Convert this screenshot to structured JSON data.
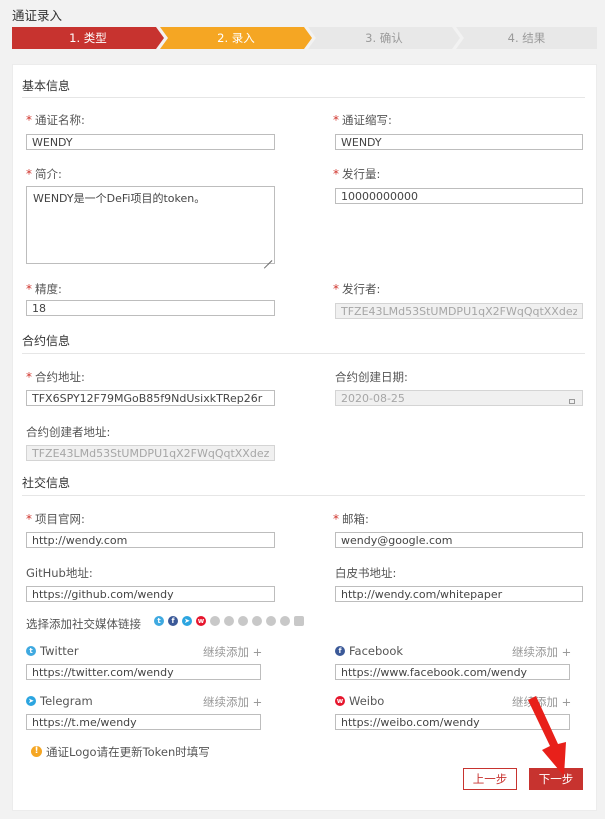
{
  "page_title": "通证录入",
  "steps": [
    "1. 类型",
    "2. 录入",
    "3. 确认",
    "4. 结果"
  ],
  "sections": {
    "basic": "基本信息",
    "contract": "合约信息",
    "social": "社交信息"
  },
  "fields": {
    "token_name": {
      "label": "通证名称:",
      "value": "WENDY"
    },
    "token_symbol": {
      "label": "通证缩写:",
      "value": "WENDY"
    },
    "intro": {
      "label": "简介:",
      "value": "WENDY是一个DeFi项目的token。"
    },
    "supply": {
      "label": "发行量:",
      "value": "10000000000"
    },
    "precision": {
      "label": "精度:",
      "value": "18"
    },
    "issuer": {
      "label": "发行者:",
      "value": "TFZE43LMd53StUMDPU1qX2FWqQqtXXdezF"
    },
    "contract_address": {
      "label": "合约地址:",
      "value": "TFX6SPY12F79MGoB85f9NdUsixkTRep26r"
    },
    "contract_date": {
      "label": "合约创建日期:",
      "value": "2020-08-25"
    },
    "contract_creator": {
      "label": "合约创建者地址:",
      "value": "TFZE43LMd53StUMDPU1qX2FWqQqtXXdezF"
    },
    "website": {
      "label": "项目官网:",
      "value": "http://wendy.com"
    },
    "email": {
      "label": "邮箱:",
      "value": "wendy@google.com"
    },
    "github": {
      "label": "GitHub地址:",
      "value": "https://github.com/wendy"
    },
    "whitepaper": {
      "label": "白皮书地址:",
      "value": "http://wendy.com/whitepaper"
    }
  },
  "social_links": {
    "label": "选择添加社交媒体链接",
    "add_more": "继续添加 +",
    "twitter": {
      "label": "Twitter",
      "value": "https://twitter.com/wendy"
    },
    "facebook": {
      "label": "Facebook",
      "value": "https://www.facebook.com/wendy"
    },
    "telegram": {
      "label": "Telegram",
      "value": "https://t.me/wendy"
    },
    "weibo": {
      "label": "Weibo",
      "value": "https://weibo.com/wendy"
    }
  },
  "note": "通证Logo请在更新Token时填写",
  "buttons": {
    "prev": "上一步",
    "next": "下一步"
  },
  "colors": {
    "primary": "#c7332f",
    "active_step": "#f5a623",
    "inactive_step": "#e8e8e8"
  },
  "icons": {
    "twitter": "twitter-icon",
    "facebook": "facebook-icon",
    "telegram": "telegram-icon",
    "weibo": "weibo-icon",
    "note": "exclamation-icon",
    "arrow": "red-arrow-annotation"
  }
}
